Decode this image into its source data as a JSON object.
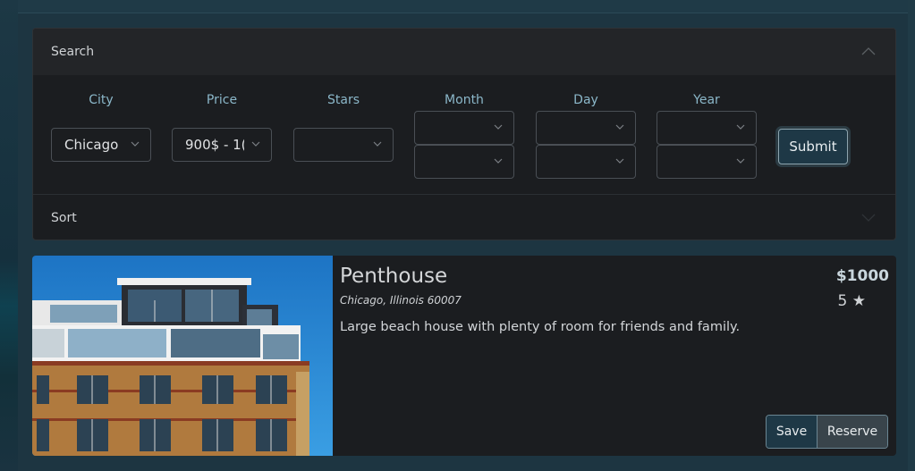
{
  "search": {
    "header_label": "Search",
    "fields": [
      {
        "label": "City",
        "value": "Chicago"
      },
      {
        "label": "Price",
        "value": "900$ - 1("
      },
      {
        "label": "Stars",
        "value": ""
      },
      {
        "label": "Month",
        "value": ""
      },
      {
        "label": "Day",
        "value": ""
      },
      {
        "label": "Year",
        "value": ""
      }
    ],
    "submit_label": "Submit",
    "sort_label": "Sort"
  },
  "listing": {
    "title": "Penthouse",
    "address": "Chicago, Illinois 60007",
    "description": "Large beach house with plenty of room for friends and family.",
    "price": "$1000",
    "rating": "5 ★",
    "save_label": "Save",
    "reserve_label": "Reserve"
  },
  "icons": [
    "chevron-up-icon",
    "chevron-down-icon"
  ],
  "colors": {
    "accent": "#8bb7c9",
    "panel_bg": "#1b1d20",
    "page_bg": "#1b3a47"
  }
}
